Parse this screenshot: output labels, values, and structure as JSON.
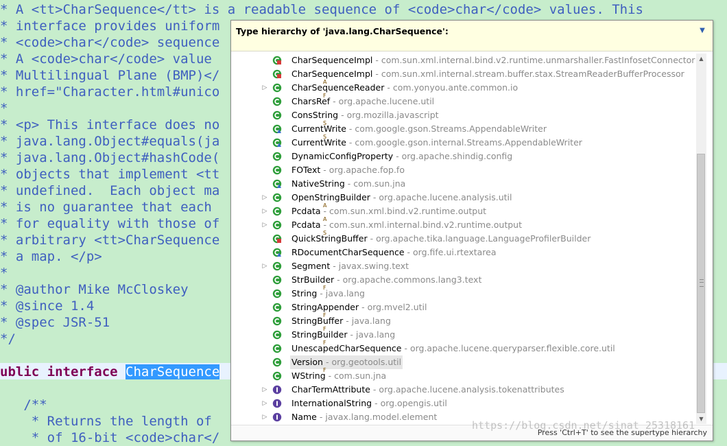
{
  "editor": {
    "lines": [
      "* A <tt>CharSequence</tt> is a readable sequence of <code>char</code> values. This",
      "* interface provides uniform",
      "* <code>char</code> sequence",
      "* A <code>char</code> value",
      "* Multilingual Plane (BMP)</",
      "* href=\"Character.html#unico",
      "*",
      "* <p> This interface does no",
      "* java.lang.Object#equals(ja",
      "* java.lang.Object#hashCode(",
      "* objects that implement <tt",
      "* undefined.  Each object ma",
      "* is no guarantee that each",
      "* for equality with those of",
      "* arbitrary <tt>CharSequence",
      "* a map. </p>",
      "*",
      "* @author Mike McCloskey",
      "* @since 1.4",
      "* @spec JSR-51",
      "*/",
      "",
      "ublic interface ",
      "",
      "   /**",
      "    * Returns the length of",
      "    * of 16-bit <code>char</"
    ],
    "selected_word": "CharSequence"
  },
  "popup": {
    "title": "Type hierarchy of 'java.lang.CharSequence':",
    "footer_hint": "Press 'Ctrl+T' to see the supertype hierarchy",
    "rows": [
      {
        "name": "CharSequenceImpl",
        "pkg": "com.sun.xml.internal.bind.v2.runtime.unmarshaller.FastInfosetConnector",
        "icon": "class-private-icon",
        "mod": "",
        "expandable": false
      },
      {
        "name": "CharSequenceImpl",
        "pkg": "com.sun.xml.internal.stream.buffer.stax.StreamReaderBufferProcessor",
        "icon": "class-private-icon",
        "mod": "",
        "expandable": false
      },
      {
        "name": "CharSequenceReader",
        "pkg": "com.yonyou.ante.common.io",
        "icon": "class-icon",
        "mod": "A",
        "expandable": true
      },
      {
        "name": "CharsRef",
        "pkg": "org.apache.lucene.util",
        "icon": "class-icon",
        "mod": "F",
        "expandable": false
      },
      {
        "name": "ConsString",
        "pkg": "org.mozilla.javascript",
        "icon": "class-icon",
        "mod": "",
        "expandable": false
      },
      {
        "name": "CurrentWrite",
        "pkg": "com.google.gson.Streams.AppendableWriter",
        "icon": "class-default-icon",
        "mod": "S",
        "expandable": false
      },
      {
        "name": "CurrentWrite",
        "pkg": "com.google.gson.internal.Streams.AppendableWriter",
        "icon": "class-default-icon",
        "mod": "S",
        "expandable": false
      },
      {
        "name": "DynamicConfigProperty",
        "pkg": "org.apache.shindig.config",
        "icon": "class-icon",
        "mod": "",
        "expandable": false
      },
      {
        "name": "FOText",
        "pkg": "org.apache.fop.fo",
        "icon": "class-icon",
        "mod": "",
        "expandable": false
      },
      {
        "name": "NativeString",
        "pkg": "com.sun.jna",
        "icon": "class-default-icon",
        "mod": "",
        "expandable": false
      },
      {
        "name": "OpenStringBuilder",
        "pkg": "org.apache.lucene.analysis.util",
        "icon": "class-icon",
        "mod": "",
        "expandable": true
      },
      {
        "name": "Pcdata",
        "pkg": "com.sun.xml.bind.v2.runtime.output",
        "icon": "class-icon",
        "mod": "A",
        "expandable": true
      },
      {
        "name": "Pcdata",
        "pkg": "com.sun.xml.internal.bind.v2.runtime.output",
        "icon": "class-icon",
        "mod": "A",
        "expandable": true
      },
      {
        "name": "QuickStringBuffer",
        "pkg": "org.apache.tika.language.LanguageProfilerBuilder",
        "icon": "class-private-icon",
        "mod": "S",
        "expandable": false
      },
      {
        "name": "RDocumentCharSequence",
        "pkg": "org.fife.ui.rtextarea",
        "icon": "class-default-icon",
        "mod": "",
        "expandable": false
      },
      {
        "name": "Segment",
        "pkg": "javax.swing.text",
        "icon": "class-icon",
        "mod": "",
        "expandable": true
      },
      {
        "name": "StrBuilder",
        "pkg": "org.apache.commons.lang3.text",
        "icon": "class-icon",
        "mod": "",
        "expandable": false
      },
      {
        "name": "String",
        "pkg": "java.lang",
        "icon": "class-icon",
        "mod": "F",
        "expandable": false
      },
      {
        "name": "StringAppender",
        "pkg": "org.mvel2.util",
        "icon": "class-icon",
        "mod": "",
        "expandable": false
      },
      {
        "name": "StringBuffer",
        "pkg": "java.lang",
        "icon": "class-icon",
        "mod": "F",
        "expandable": false
      },
      {
        "name": "StringBuilder",
        "pkg": "java.lang",
        "icon": "class-icon",
        "mod": "F",
        "expandable": false
      },
      {
        "name": "UnescapedCharSequence",
        "pkg": "org.apache.lucene.queryparser.flexible.core.util",
        "icon": "class-icon",
        "mod": "F",
        "expandable": false
      },
      {
        "name": "Version",
        "pkg": "org.geotools.util",
        "icon": "class-icon",
        "mod": "",
        "expandable": false,
        "selected": true
      },
      {
        "name": "WString",
        "pkg": "com.sun.jna",
        "icon": "class-icon",
        "mod": "F",
        "expandable": false
      },
      {
        "name": "CharTermAttribute",
        "pkg": "org.apache.lucene.analysis.tokenattributes",
        "icon": "interface-icon",
        "mod": "",
        "expandable": true
      },
      {
        "name": "InternationalString",
        "pkg": "org.opengis.util",
        "icon": "interface-icon",
        "mod": "",
        "expandable": true
      },
      {
        "name": "Name",
        "pkg": "javax.lang.model.element",
        "icon": "interface-icon",
        "mod": "",
        "expandable": true
      }
    ]
  },
  "watermark": "https://blog.csdn.net/sinat_25318161",
  "colors": {
    "editor_bg": "#c7edcc",
    "comment": "#3f5fbf",
    "keyword": "#7f0055",
    "selection": "#3399ff",
    "popup_header_bg": "#ffffe1",
    "class_icon": "#2e9e3a",
    "interface_icon": "#5b3fa0",
    "package_text": "#8a8a8a"
  }
}
